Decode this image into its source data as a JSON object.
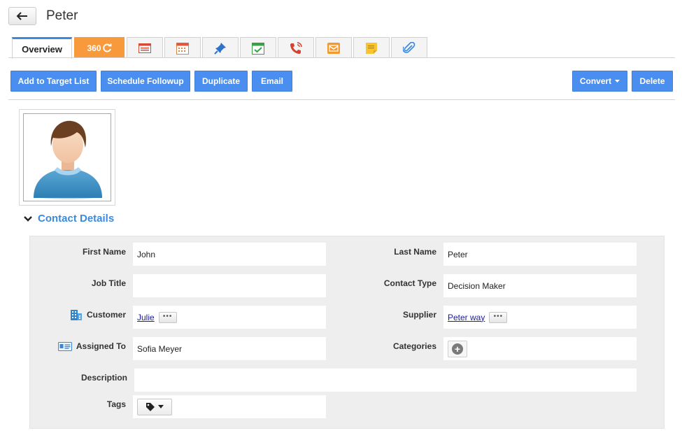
{
  "header": {
    "title": "Peter",
    "back_icon": "back-arrow-icon"
  },
  "tabs": [
    {
      "label": "Overview",
      "icon": null
    },
    {
      "label": "360",
      "icon": "refresh-icon"
    },
    {
      "label": "",
      "icon": "newspaper-icon"
    },
    {
      "label": "",
      "icon": "calendar-icon"
    },
    {
      "label": "",
      "icon": "pin-icon"
    },
    {
      "label": "",
      "icon": "task-icon"
    },
    {
      "label": "",
      "icon": "phone-call-icon"
    },
    {
      "label": "",
      "icon": "email-icon"
    },
    {
      "label": "",
      "icon": "note-icon"
    },
    {
      "label": "",
      "icon": "attachment-icon"
    }
  ],
  "toolbar": {
    "add_to_target_list": "Add to Target List",
    "schedule_followup": "Schedule Followup",
    "duplicate": "Duplicate",
    "email": "Email",
    "convert": "Convert",
    "delete": "Delete"
  },
  "section": {
    "title": "Contact Details"
  },
  "fields": {
    "first_name": {
      "label": "First Name",
      "value": "John"
    },
    "last_name": {
      "label": "Last Name",
      "value": "Peter"
    },
    "job_title": {
      "label": "Job Title",
      "value": ""
    },
    "contact_type": {
      "label": "Contact Type",
      "value": "Decision Maker"
    },
    "customer": {
      "label": "Customer",
      "value": "Julie"
    },
    "supplier": {
      "label": "Supplier",
      "value": "Peter way"
    },
    "assigned_to": {
      "label": "Assigned To",
      "value": "Sofia Meyer"
    },
    "categories": {
      "label": "Categories",
      "value": ""
    },
    "description": {
      "label": "Description",
      "value": ""
    },
    "tags": {
      "label": "Tags",
      "value": ""
    }
  },
  "colors": {
    "primary_button": "#4a8ff0",
    "accent_360": "#f89a3b",
    "section_title": "#3a8ae0",
    "panel_bg": "#eeeeee"
  }
}
